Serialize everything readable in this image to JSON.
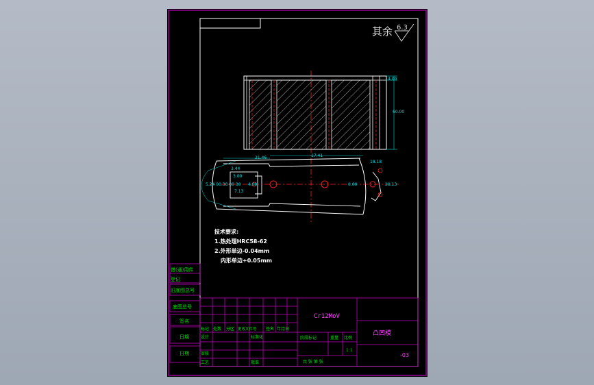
{
  "surface_finish": {
    "label": "其余",
    "value": "6.3"
  },
  "dimensions": {
    "top_small": "4.00",
    "height": "60.00",
    "length": "17.41",
    "left_width": "21.46",
    "left_a": "3.44",
    "left_b": "3.00",
    "left_c": "4.00",
    "right_a": "18.18",
    "right_b": "20.13",
    "left_stack": "5.24 00.38 00 30",
    "center_small": "0.00",
    "bottom_left": "7.13"
  },
  "notes": {
    "title": "技术要求:",
    "line1": "1.热处理HRC58-62",
    "line2": "2.外形单边-0.04mm",
    "line3": "内形单边+0.05mm"
  },
  "left_column": {
    "c1": "借(通)用件",
    "c2": "登记",
    "c3": "旧底图总号",
    "c4": "底图总号",
    "c5": "签名",
    "c6": "日期",
    "c7": "日期"
  },
  "title_block": {
    "material": "Cr12MoV",
    "part_name": "凸凹模",
    "drawing_no": "-03",
    "hdr_mark": "标记",
    "hdr_count": "处数",
    "hdr_zone": "分区",
    "hdr_doc": "更改文件号",
    "hdr_sign": "签名",
    "hdr_date": "年月日",
    "design": "设计",
    "standard": "标准化",
    "review": "审核",
    "process": "工艺",
    "approve": "批准",
    "stage_mark": "阶段标记",
    "weight": "重量",
    "ratio": "比例",
    "scale": "1:1",
    "sheets": "共 张 第 张"
  }
}
